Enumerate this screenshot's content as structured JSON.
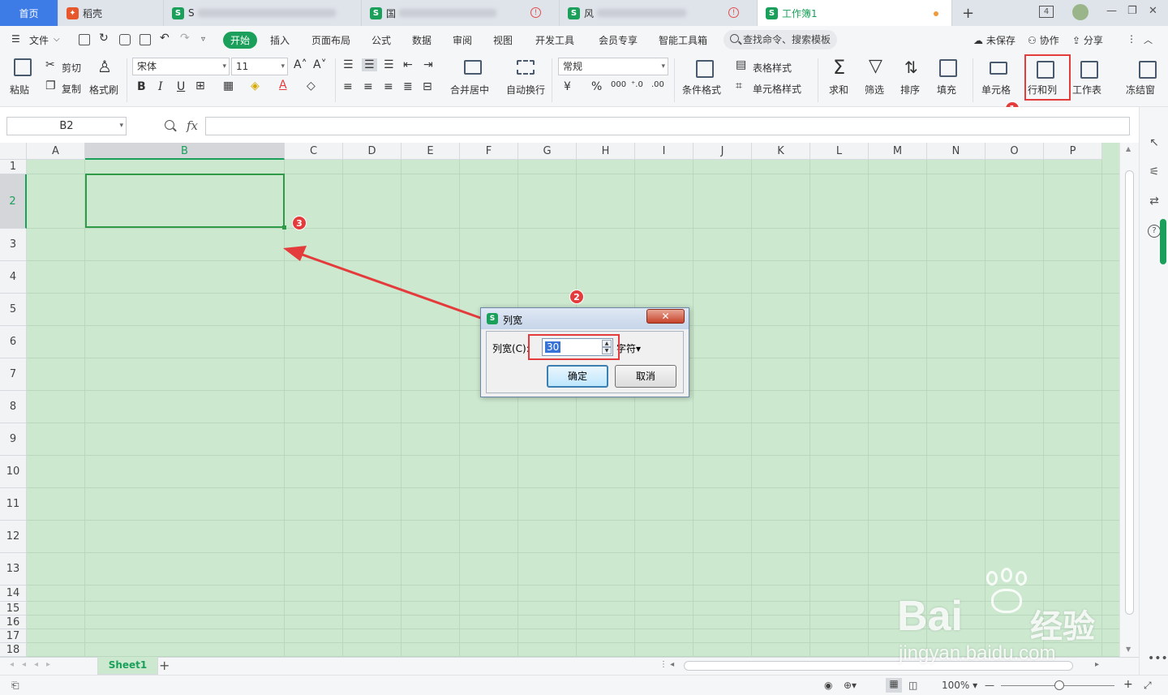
{
  "tabs": {
    "home": "首页",
    "docer": "稻壳",
    "doc2": "S",
    "doc3": "国",
    "doc4": "风",
    "active": "工作簿1"
  },
  "titlebar": {
    "window_count": "4"
  },
  "menu": {
    "file": "文件",
    "start": "开始",
    "items": [
      "插入",
      "页面布局",
      "公式",
      "数据",
      "审阅",
      "视图",
      "开发工具",
      "会员专享",
      "智能工具箱"
    ],
    "search": "查找命令、搜索模板",
    "unsaved": "未保存",
    "collab": "协作",
    "share": "分享"
  },
  "ribbon": {
    "paste": "粘贴",
    "cut": "剪切",
    "copy": "复制",
    "format_painter": "格式刷",
    "font": "宋体",
    "size": "11",
    "merge": "合并居中",
    "wrap": "自动换行",
    "number_format": "常规",
    "cond_format": "条件格式",
    "table_style": "表格样式",
    "cell_style": "单元格样式",
    "sum": "求和",
    "filter": "筛选",
    "sort": "排序",
    "fill": "填充",
    "cell": "单元格",
    "rowcol": "行和列",
    "sheet": "工作表",
    "freeze": "冻结窗"
  },
  "formula": {
    "cell_ref": "B2",
    "fx": "fx"
  },
  "grid": {
    "columns": [
      "A",
      "B",
      "C",
      "D",
      "E",
      "F",
      "G",
      "H",
      "I",
      "J",
      "K",
      "L",
      "M",
      "N",
      "O",
      "P"
    ],
    "rows": [
      "1",
      "2",
      "3",
      "4",
      "5",
      "6",
      "7",
      "8",
      "9",
      "10",
      "11",
      "12",
      "13",
      "14",
      "15",
      "16",
      "17",
      "18"
    ],
    "selected_col": "B",
    "selected_row": "2"
  },
  "dialog": {
    "title": "列宽",
    "label": "列宽(C):",
    "value": "30",
    "unit": "字符▾",
    "ok": "确定",
    "cancel": "取消"
  },
  "annotations": {
    "b1": "1",
    "b2": "2",
    "b3": "3"
  },
  "sheets": {
    "active": "Sheet1"
  },
  "status": {
    "zoom": "100%"
  },
  "watermark": {
    "brand": "Bai",
    "brand2": "经验",
    "url": "jingyan.baidu.com"
  },
  "colors": {
    "accent": "#1aa05a",
    "annotation": "#e43c3c",
    "grid_bg": "#cce8cf"
  }
}
